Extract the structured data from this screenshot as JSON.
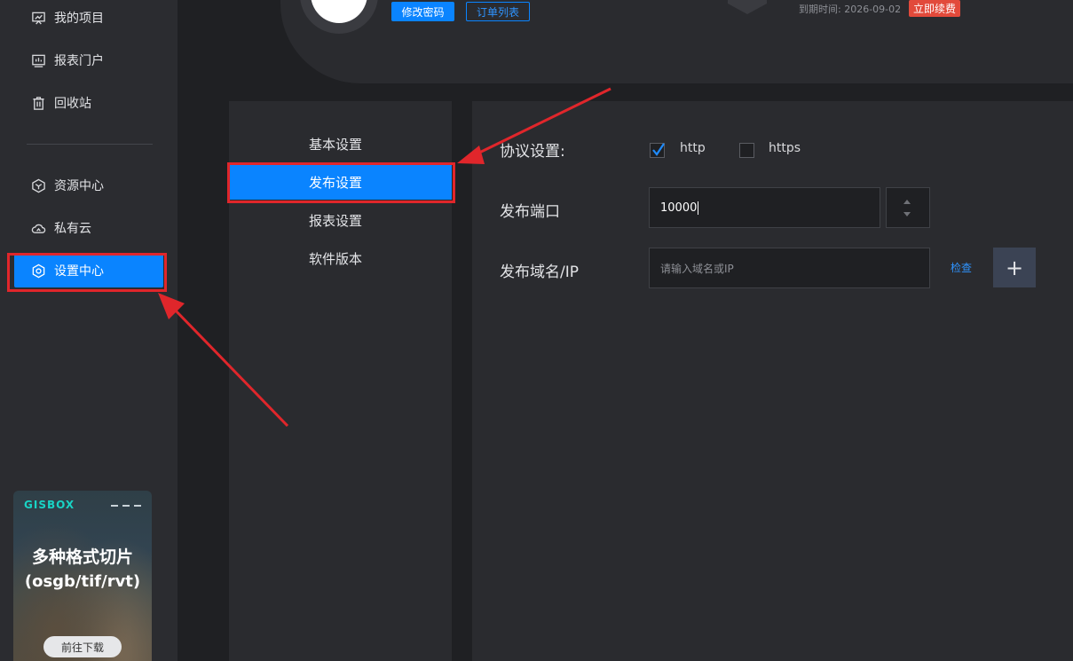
{
  "sidebar": {
    "items": [
      {
        "label": "我的项目",
        "icon": "presentation-board-icon"
      },
      {
        "label": "报表门户",
        "icon": "report-monitor-icon"
      },
      {
        "label": "回收站",
        "icon": "trash-icon"
      },
      {
        "label": "资源中心",
        "icon": "cube-icon"
      },
      {
        "label": "私有云",
        "icon": "cloud-icon"
      },
      {
        "label": "设置中心",
        "icon": "gear-icon",
        "active": true
      }
    ],
    "promo": {
      "brand": "GISBOX",
      "line1": "多种格式切片",
      "line2": "(osgb/tif/rvt)",
      "button": "前往下载"
    }
  },
  "profile": {
    "change_password": "修改密码",
    "orders": "订单列表",
    "expire_label": "到期时间:",
    "expire_date": "2026-09-02",
    "renew": "立即续费"
  },
  "submenu": {
    "items": [
      {
        "label": "基本设置"
      },
      {
        "label": "发布设置",
        "active": true
      },
      {
        "label": "报表设置"
      },
      {
        "label": "软件版本"
      }
    ]
  },
  "settings": {
    "protocol_label": "协议设置:",
    "http_label": "http",
    "http_checked": true,
    "https_label": "https",
    "https_checked": false,
    "port_label": "发布端口",
    "port_value": "10000",
    "domain_label": "发布域名/IP",
    "domain_placeholder": "请输入域名或IP",
    "check_label": "检查",
    "add_symbol": "+"
  },
  "colors": {
    "accent": "#0a84ff",
    "annotation": "#e0262b",
    "renew": "#e24a3b"
  }
}
